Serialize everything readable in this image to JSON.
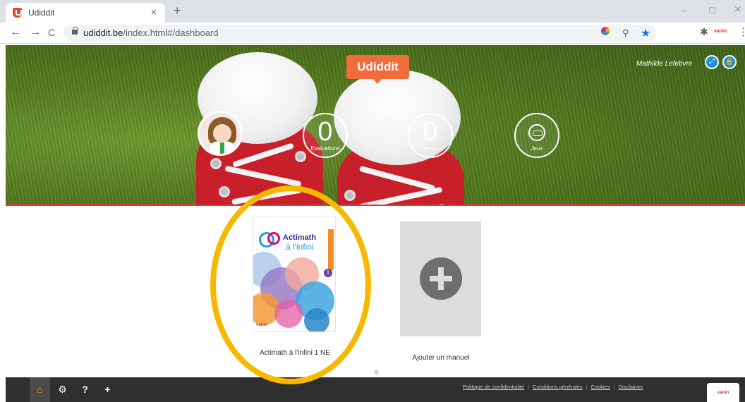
{
  "browser": {
    "tab_title": "Udiddit",
    "tab_close": "×",
    "new_tab": "+",
    "url_host": "udiddit.be",
    "url_path": "/index.html#/dashboard",
    "nav_back": "←",
    "nav_forward": "→",
    "nav_reload": "C",
    "zoom_icon": "⚲",
    "star_icon": "★",
    "puzzle_icon": "✱",
    "extension_label": "vanin",
    "menu_icon": "⋮",
    "window_minimize": "–",
    "window_maximize": "◻",
    "window_close": "✕"
  },
  "header": {
    "brand": "Udiddit",
    "user_name": "Mathilde Lefebvre",
    "expand_icon": "⤢",
    "lock_icon": "🔒",
    "stats": [
      {
        "value": "0",
        "label": "Evaluations"
      },
      {
        "value": "0",
        "label": "Devoirs"
      },
      {
        "value": "",
        "label": "Jeux",
        "icon": "gamepad-icon"
      }
    ]
  },
  "content": {
    "book": {
      "cover_title": "Actimath",
      "cover_subtitle": "à l'infini",
      "cover_number": "1",
      "cover_publisher": "vanin",
      "caption": "Actimath à l'infini 1 NE"
    },
    "add_manual_caption": "Ajouter un manuel",
    "drag_handle": "≡",
    "highlight_color": "#f6b900"
  },
  "footer": {
    "buttons": [
      {
        "icon": "home-icon",
        "glyph": "⌂",
        "active": true
      },
      {
        "icon": "gear-icon",
        "glyph": "⚙",
        "active": false
      },
      {
        "icon": "help-icon",
        "glyph": "❓",
        "active": false
      },
      {
        "icon": "add-icon",
        "glyph": "⊕",
        "active": false
      }
    ],
    "home_glyph": "⌂",
    "settings_glyph": "⚙",
    "help_glyph": "?",
    "add_glyph": "+",
    "links": [
      "Politique de confidentialité",
      "Conditions générales",
      "Cookies",
      "Disclaimer"
    ],
    "publisher_tab": "vanin"
  },
  "colors": {
    "brand_orange": "#f26b3a",
    "hero_accent_red": "#e0392f",
    "footer_bg": "#2f2f2f",
    "button_blue": "#1a8fd1"
  }
}
